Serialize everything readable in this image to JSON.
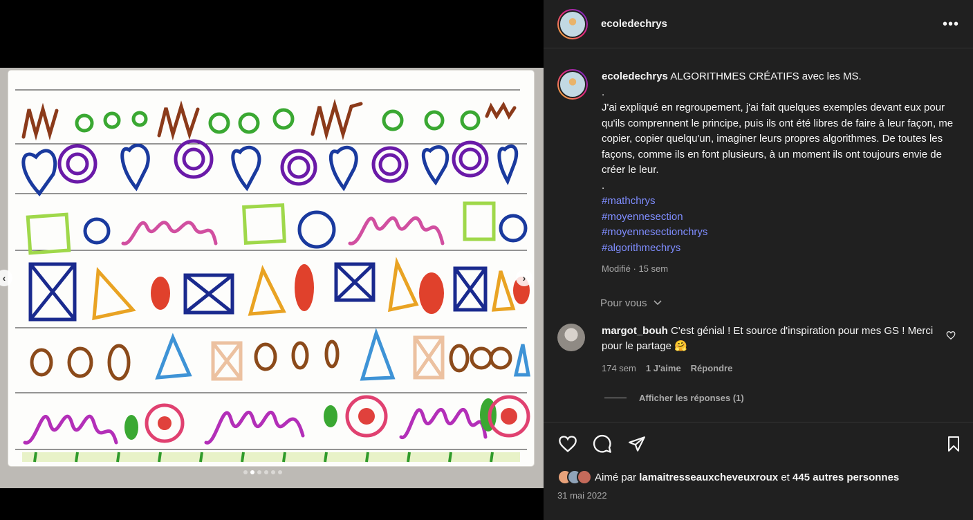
{
  "post": {
    "username": "ecoledechrys",
    "more_label": "•••"
  },
  "caption": {
    "username": "ecoledechrys",
    "title": "ALGORITHMES CRÉATIFS avec les MS.",
    "dot1": ".",
    "paragraph": "J'ai expliqué en regroupement, j'ai fait quelques exemples devant eux pour qu'ils comprennent le principe, puis ils ont été libres de faire à leur façon, me copier, copier quelqu'un, imaginer leurs propres algorithmes. De toutes les façons, comme ils en font plusieurs, à un moment ils ont toujours envie de créer le leur.",
    "dot2": ".",
    "hashtags": [
      "#mathchrys",
      "#moyennesection",
      "#moyennesectionchrys",
      "#algorithmechrys"
    ],
    "meta": "Modifié · 15 sem"
  },
  "pour_vous": "Pour vous",
  "comment": {
    "username": "margot_bouh",
    "text": "C'est génial ! Et source d'inspiration pour mes GS ! Merci pour le partage 🤗",
    "time": "174 sem",
    "likes": "1 J'aime",
    "reply": "Répondre",
    "show_replies": "Afficher les réponses (1)"
  },
  "likes": {
    "prefix": "Aimé par",
    "user": "lamaitresseauxcheveuxroux",
    "connector": "et",
    "others": "445 autres personnes"
  },
  "date": "31 mai 2022",
  "carousel": {
    "prev_icon": "‹",
    "next_icon": "›",
    "dot_count": 6,
    "active_index": 1
  },
  "colors": {
    "panel_bg": "#202020",
    "hashtag": "#7f8dff",
    "muted": "#a8a8a8"
  }
}
